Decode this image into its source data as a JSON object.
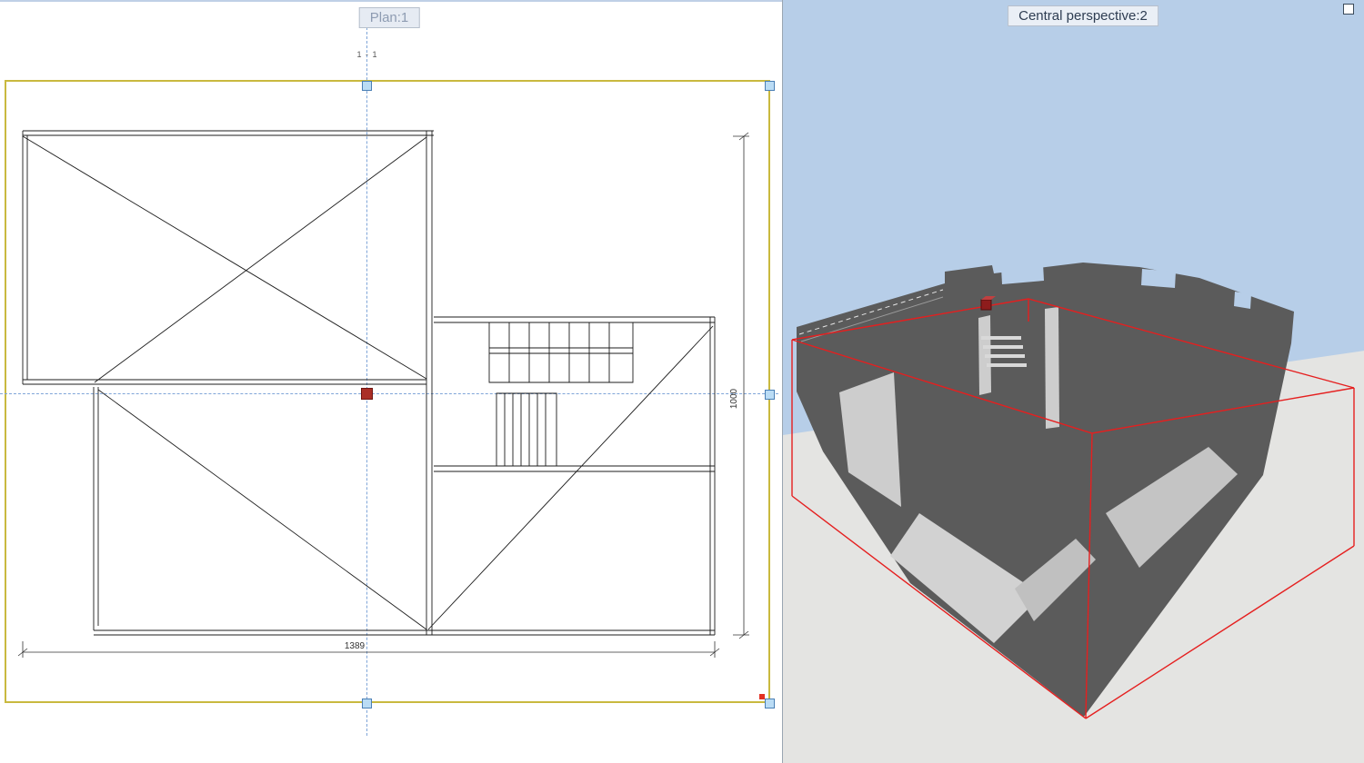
{
  "plan_viewport": {
    "tab_label": "Plan:1",
    "ref_label": "1 - 1",
    "dimensions": {
      "vertical": "1000",
      "horizontal": "1389"
    }
  },
  "perspective_viewport": {
    "tab_label": "Central perspective:2"
  },
  "colors": {
    "selection_yellow": "#c9b93f",
    "handle_fill": "#badcf5",
    "handle_border": "#4a7fb5",
    "crosshair": "#7fa5d8",
    "marker_red": "#aa2e26",
    "wireframe_red": "#e51f1f",
    "sky": "#b7cee8",
    "ground": "#e4e4e2",
    "building": "#5b5b5b",
    "plan_line": "#1c1c1c"
  }
}
